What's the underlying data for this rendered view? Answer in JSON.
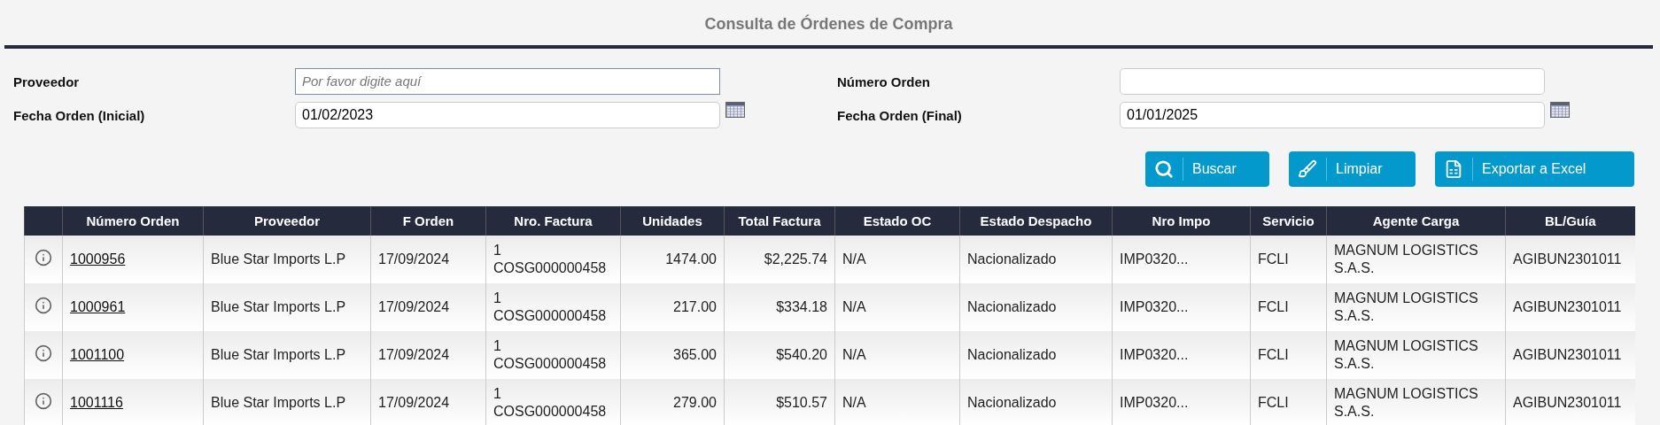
{
  "title": "Consulta de Órdenes de Compra",
  "filters": [
    {
      "label": "Proveedor",
      "placeholder": "Por favor digite aquí",
      "kind": "text"
    },
    {
      "label": "Número Orden",
      "kind": "text"
    },
    {
      "label": "Fecha Orden (Inicial)",
      "value": "01/02/2023",
      "kind": "date"
    },
    {
      "label": "Fecha Orden (Final)",
      "value": "01/01/2025",
      "kind": "date"
    }
  ],
  "buttons": [
    {
      "label": "Buscar",
      "kind": "search"
    },
    {
      "label": "Limpiar",
      "kind": "clear"
    },
    {
      "label": "Exportar a Excel",
      "kind": "export"
    }
  ],
  "table": {
    "columns": [
      "",
      "Número Orden",
      "Proveedor",
      "F Orden",
      "Nro. Factura",
      "Unidades",
      "Total Factura",
      "Estado OC",
      "Estado Despacho",
      "Nro Impo",
      "Servicio",
      "Agente Carga",
      "BL/Guía"
    ],
    "rows": [
      {
        "numero_orden": "1000956",
        "proveedor": "Blue Star Imports L.P",
        "f_orden": "17/09/2024",
        "nro_factura": "1\nCOSG000000458",
        "unidades": "1474.00",
        "total_factura": "$2,225.74",
        "estado_oc": "N/A",
        "estado_despacho": "Nacionalizado",
        "nro_impo": "IMP0320...",
        "servicio": "FCLI",
        "agente_carga": "MAGNUM LOGISTICS S.A.S.",
        "bl_guia": "AGIBUN2301011"
      },
      {
        "numero_orden": "1000961",
        "proveedor": "Blue Star Imports L.P",
        "f_orden": "17/09/2024",
        "nro_factura": "1\nCOSG000000458",
        "unidades": "217.00",
        "total_factura": "$334.18",
        "estado_oc": "N/A",
        "estado_despacho": "Nacionalizado",
        "nro_impo": "IMP0320...",
        "servicio": "FCLI",
        "agente_carga": "MAGNUM LOGISTICS S.A.S.",
        "bl_guia": "AGIBUN2301011"
      },
      {
        "numero_orden": "1001100",
        "proveedor": "Blue Star Imports L.P",
        "f_orden": "17/09/2024",
        "nro_factura": "1\nCOSG000000458",
        "unidades": "365.00",
        "total_factura": "$540.20",
        "estado_oc": "N/A",
        "estado_despacho": "Nacionalizado",
        "nro_impo": "IMP0320...",
        "servicio": "FCLI",
        "agente_carga": "MAGNUM LOGISTICS S.A.S.",
        "bl_guia": "AGIBUN2301011"
      },
      {
        "numero_orden": "1001116",
        "proveedor": "Blue Star Imports L.P",
        "f_orden": "17/09/2024",
        "nro_factura": "1\nCOSG000000458",
        "unidades": "279.00",
        "total_factura": "$510.57",
        "estado_oc": "N/A",
        "estado_despacho": "Nacionalizado",
        "nro_impo": "IMP0320...",
        "servicio": "FCLI",
        "agente_carga": "MAGNUM LOGISTICS S.A.S.",
        "bl_guia": "AGIBUN2301011"
      }
    ]
  }
}
